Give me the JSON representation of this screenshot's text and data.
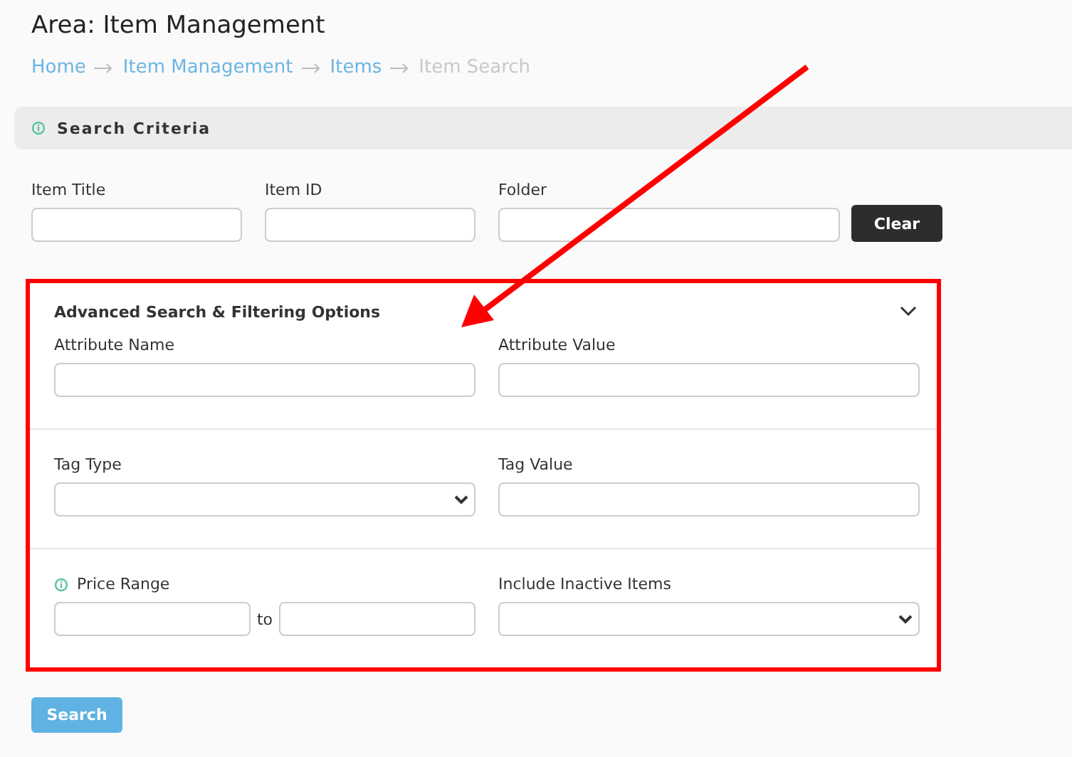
{
  "page": {
    "title": "Area: Item Management"
  },
  "breadcrumb": [
    {
      "label": "Home",
      "current": false
    },
    {
      "label": "Item Management",
      "current": false
    },
    {
      "label": "Items",
      "current": false
    },
    {
      "label": "Item Search",
      "current": true
    }
  ],
  "search_criteria": {
    "title": "Search Criteria",
    "fields": [
      {
        "label": "Item Title",
        "kind": "input"
      },
      {
        "label": "Item ID",
        "kind": "input"
      },
      {
        "label": "Folder",
        "kind": "input"
      }
    ],
    "clear_button": "Clear"
  },
  "advanced": {
    "title": "Advanced Search & Filtering Options",
    "expanded": true,
    "rows": [
      [
        {
          "label": "Attribute Name",
          "kind": "input"
        },
        {
          "label": "Attribute Value",
          "kind": "input"
        }
      ],
      [
        {
          "label": "Tag Type",
          "kind": "select"
        },
        {
          "label": "Tag Value",
          "kind": "input"
        }
      ],
      [
        {
          "label": "Price Range",
          "kind": "range",
          "separator": "to",
          "info": true
        },
        {
          "label": "Include Inactive Items",
          "kind": "select"
        }
      ]
    ]
  },
  "search_button": "Search"
}
